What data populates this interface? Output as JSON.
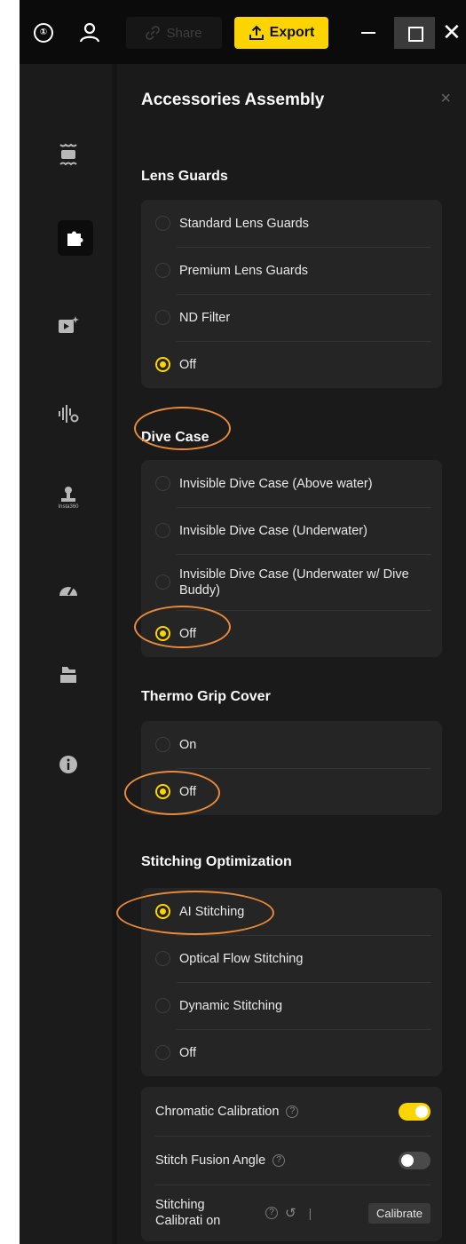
{
  "topbar": {
    "logo_text": "①",
    "share_label": "Share",
    "export_label": "Export",
    "colors": {
      "export_bg": "#fcd500",
      "bar_bg": "#0b0b0b"
    }
  },
  "sidebar": {
    "icons": [
      "stabilization-icon",
      "accessories-puzzle-icon",
      "video-effects-icon",
      "audio-settings-icon",
      "watermark-icon",
      "speed-gauge-icon",
      "export-folder-icon",
      "info-icon"
    ],
    "watermark_text": "Insta360",
    "active": "accessories-puzzle-icon"
  },
  "panel": {
    "title": "Accessories Assembly",
    "close": "×",
    "sections": [
      {
        "title": "Lens Guards",
        "options": [
          {
            "label": "Standard Lens Guards",
            "selected": false
          },
          {
            "label": "Premium Lens Guards",
            "selected": false
          },
          {
            "label": "ND Filter",
            "selected": false
          },
          {
            "label": "Off",
            "selected": true
          }
        ]
      },
      {
        "title": "Dive Case",
        "options": [
          {
            "label": "Invisible Dive Case (Above water)",
            "selected": false
          },
          {
            "label": "Invisible Dive Case (Underwater)",
            "selected": false
          },
          {
            "label": "Invisible Dive Case (Underwater w/ Dive Buddy)",
            "selected": false
          },
          {
            "label": "Off",
            "selected": true
          }
        ]
      },
      {
        "title": "Thermo Grip Cover",
        "options": [
          {
            "label": "On",
            "selected": false
          },
          {
            "label": "Off",
            "selected": true
          }
        ]
      },
      {
        "title": "Stitching Optimization",
        "options": [
          {
            "label": "AI Stitching",
            "selected": true
          },
          {
            "label": "Optical Flow Stitching",
            "selected": false
          },
          {
            "label": "Dynamic Stitching",
            "selected": false
          },
          {
            "label": "Off",
            "selected": false
          }
        ]
      }
    ],
    "settings": {
      "chromatic_label": "Chromatic Calibration",
      "chromatic_on": true,
      "fusion_label": "Stitch Fusion Angle",
      "fusion_on": false,
      "stitch_cal_label": "Stitching Calibrati on",
      "separator": "|",
      "calibrate_label": "Calibrate"
    }
  },
  "colors": {
    "accent": "#fcd500",
    "highlight_ring": "#ea8a38",
    "panel_bg": "#1a1a1a",
    "card_bg": "#252525"
  }
}
